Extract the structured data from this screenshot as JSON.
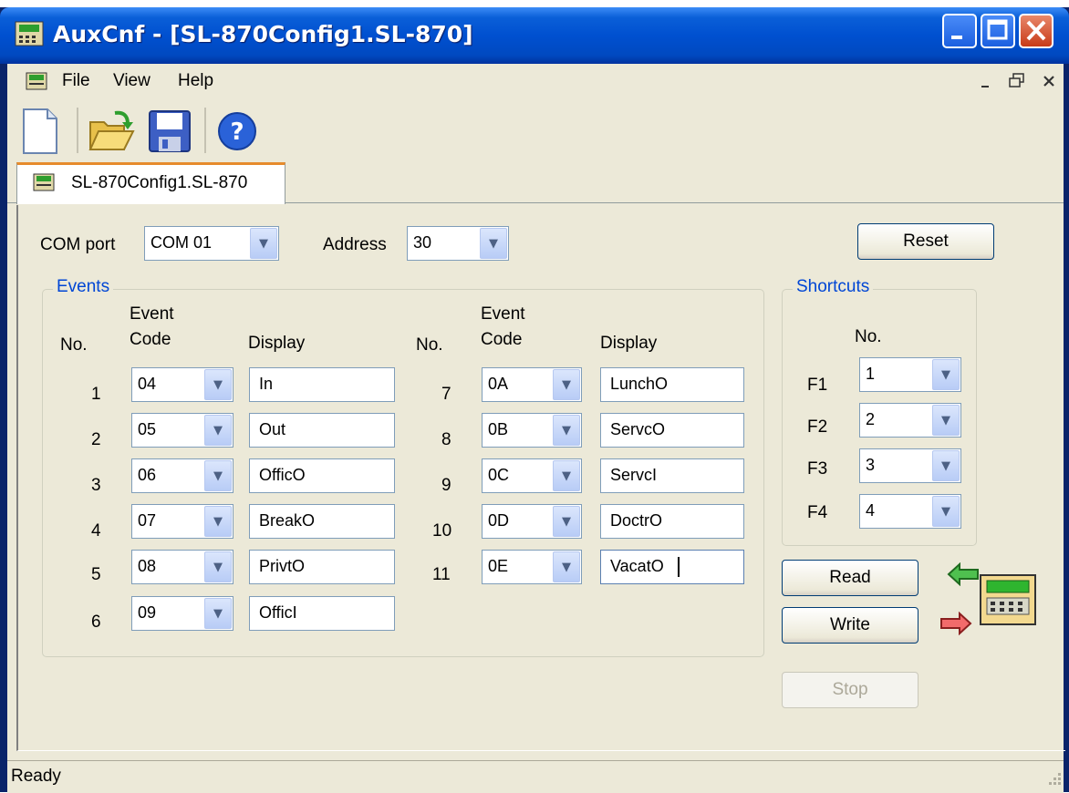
{
  "window": {
    "title": "AuxCnf - [SL-870Config1.SL-870]"
  },
  "menu": {
    "items": [
      "File",
      "View",
      "Help"
    ]
  },
  "toolbar": {
    "icons": [
      "new-icon",
      "open-icon",
      "save-icon",
      "help-icon"
    ]
  },
  "tab": {
    "label": "SL-870Config1.SL-870"
  },
  "connection": {
    "com_port_label": "COM port",
    "com_port_value": "COM 01",
    "address_label": "Address",
    "address_value": "30",
    "reset_label": "Reset"
  },
  "events": {
    "group_title": "Events",
    "hdr_no": "No.",
    "hdr_event": "Event",
    "hdr_code": "Code",
    "hdr_display": "Display",
    "rows": [
      {
        "no": "1",
        "code": "04",
        "display": "In"
      },
      {
        "no": "2",
        "code": "05",
        "display": "Out"
      },
      {
        "no": "3",
        "code": "06",
        "display": "OfficO"
      },
      {
        "no": "4",
        "code": "07",
        "display": "BreakO"
      },
      {
        "no": "5",
        "code": "08",
        "display": "PrivtO"
      },
      {
        "no": "6",
        "code": "09",
        "display": "OfficI"
      },
      {
        "no": "7",
        "code": "0A",
        "display": "LunchO"
      },
      {
        "no": "8",
        "code": "0B",
        "display": "ServcO"
      },
      {
        "no": "9",
        "code": "0C",
        "display": "ServcI"
      },
      {
        "no": "10",
        "code": "0D",
        "display": "DoctrO"
      },
      {
        "no": "11",
        "code": "0E",
        "display": "VacatO"
      }
    ]
  },
  "shortcuts": {
    "group_title": "Shortcuts",
    "hdr_no": "No.",
    "rows": [
      {
        "key": "F1",
        "value": "1"
      },
      {
        "key": "F2",
        "value": "2"
      },
      {
        "key": "F3",
        "value": "3"
      },
      {
        "key": "F4",
        "value": "4"
      }
    ]
  },
  "actions": {
    "read": "Read",
    "write": "Write",
    "stop": "Stop"
  },
  "status": {
    "text": "Ready"
  }
}
